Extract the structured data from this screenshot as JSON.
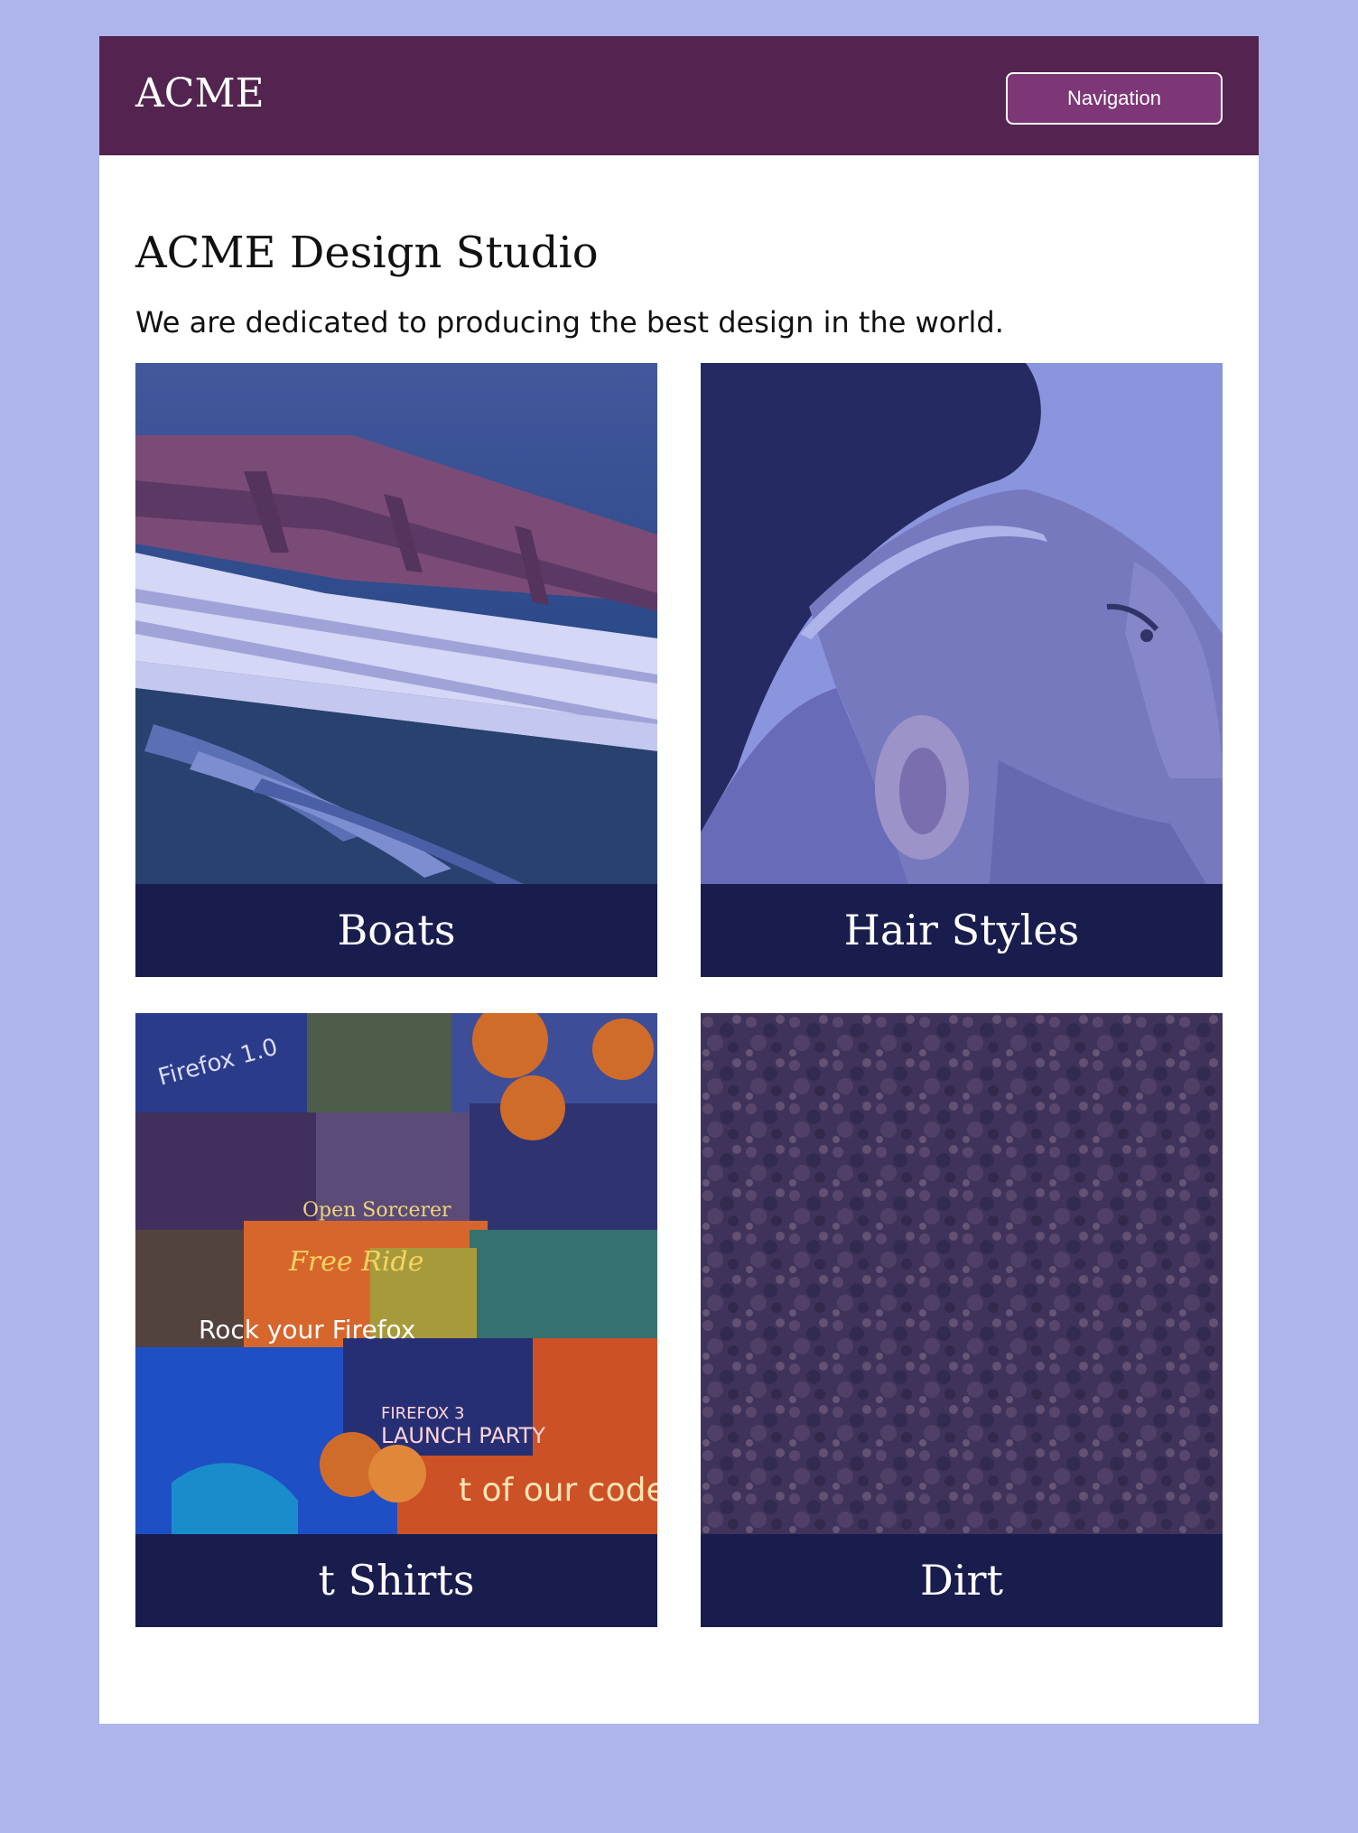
{
  "header": {
    "logo": "ACME",
    "nav_button": "Navigation"
  },
  "main": {
    "title": "ACME Design Studio",
    "intro": "We are dedicated to producing the best design in the world."
  },
  "cards": [
    {
      "caption": "Boats"
    },
    {
      "caption": "Hair Styles"
    },
    {
      "caption": "t Shirts"
    },
    {
      "caption": "Dirt"
    }
  ],
  "tshirt_texts": [
    "Firefox 1.0",
    "Open Sorcerer",
    "Free Ride",
    "Rock your Firefox",
    "FIREFOX 3",
    "LAUNCH PARTY",
    "t of our code"
  ],
  "colors": {
    "page_background": "#adb5ec",
    "header_background": "#53244f",
    "nav_button": "#7d3777",
    "caption_background": "#191d4d"
  }
}
